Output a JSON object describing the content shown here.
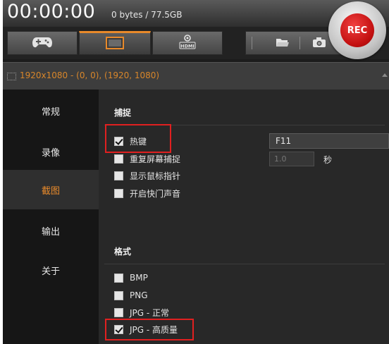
{
  "header": {
    "timer": "00:00:00",
    "file_size": "0 bytes / 77.5GB",
    "rec_label": "REC"
  },
  "toolbar": {
    "modes": [
      {
        "icon": "gamepad-icon",
        "active": false
      },
      {
        "icon": "screen-capture-icon",
        "active": true
      },
      {
        "icon": "hdmi-icon",
        "active": false
      }
    ],
    "tools": [
      {
        "icon": "folder-icon"
      },
      {
        "icon": "camera-icon"
      }
    ]
  },
  "capture_region": {
    "text": "1920x1080 - (0, 0), (1920, 1080)"
  },
  "sidebar": {
    "items": [
      {
        "label": "常规",
        "active": false
      },
      {
        "label": "录像",
        "active": false
      },
      {
        "label": "截图",
        "active": true
      },
      {
        "label": "输出",
        "active": false
      },
      {
        "label": "关于",
        "active": false
      }
    ]
  },
  "capture": {
    "title": "捕捉",
    "hotkey_label": "热键",
    "hotkey_checked": true,
    "hotkey_value": "F11",
    "repeat_label": "重复屏幕捕捉",
    "repeat_checked": false,
    "repeat_interval": "1.0",
    "repeat_unit": "秒",
    "cursor_label": "显示鼠标指针",
    "cursor_checked": false,
    "shutter_label": "开启快门声音",
    "shutter_checked": false
  },
  "format": {
    "title": "格式",
    "options": [
      {
        "label": "BMP",
        "checked": false
      },
      {
        "label": "PNG",
        "checked": false
      },
      {
        "label": "JPG - 正常",
        "checked": false
      },
      {
        "label": "JPG - 高质量",
        "checked": true
      }
    ]
  },
  "colors": {
    "accent": "#e8892a",
    "rec": "#c31010",
    "highlight": "#e02020"
  }
}
